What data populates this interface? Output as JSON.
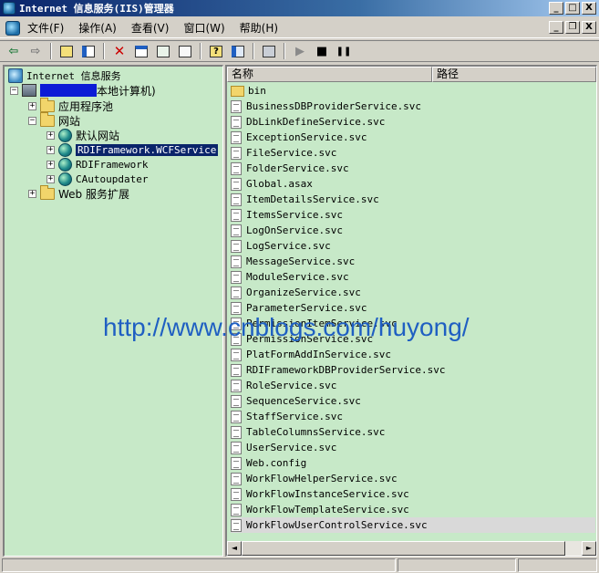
{
  "window": {
    "title": "Internet 信息服务(IIS)管理器",
    "controls": {
      "minimize": "_",
      "maximize": "□",
      "close": "X"
    }
  },
  "menubar": {
    "items": [
      {
        "label": "文件(F)"
      },
      {
        "label": "操作(A)"
      },
      {
        "label": "查看(V)"
      },
      {
        "label": "窗口(W)"
      },
      {
        "label": "帮助(H)"
      }
    ],
    "mdi_controls": {
      "minimize": "_",
      "restore": "❐",
      "close": "X"
    }
  },
  "toolbar": {
    "buttons": [
      {
        "icon": "back-icon",
        "glyph": "⇦",
        "color": "#1f7a3a"
      },
      {
        "icon": "forward-icon",
        "glyph": "⇨",
        "color": "#7a7a7a"
      },
      {
        "icon": "up-folder-icon"
      },
      {
        "icon": "show-tree-icon"
      },
      {
        "icon": "delete-icon",
        "glyph": "✕",
        "color": "#cc0000"
      },
      {
        "icon": "properties-icon"
      },
      {
        "icon": "refresh-icon"
      },
      {
        "icon": "export-icon"
      },
      {
        "icon": "help-icon",
        "glyph": "?"
      },
      {
        "icon": "view-icon"
      },
      {
        "icon": "computer-icon"
      },
      {
        "icon": "start-icon",
        "glyph": "▶",
        "color": "#8a8a8a"
      },
      {
        "icon": "stop-icon",
        "glyph": "■",
        "color": "#000000"
      },
      {
        "icon": "pause-icon",
        "glyph": "❚❚",
        "color": "#000000"
      }
    ]
  },
  "tree": {
    "root": {
      "label": "Internet 信息服务"
    },
    "computer": {
      "label": "本地计算机)",
      "expander": "−"
    },
    "app_pools": {
      "label": "应用程序池",
      "expander": "+"
    },
    "websites": {
      "label": "网站",
      "expander": "−"
    },
    "sites": [
      {
        "label": "默认网站",
        "expander": "+",
        "selected": false
      },
      {
        "label": "RDIFramework.WCFService",
        "expander": "+",
        "selected": true
      },
      {
        "label": "RDIFramework",
        "expander": "+",
        "selected": false
      },
      {
        "label": "CAutoupdater",
        "expander": "+",
        "selected": false
      }
    ],
    "web_ext": {
      "label": "Web 服务扩展",
      "expander": "+"
    }
  },
  "list": {
    "columns": [
      {
        "label": "名称"
      },
      {
        "label": "路径"
      }
    ],
    "items": [
      {
        "name": "bin",
        "type": "folder"
      },
      {
        "name": "BusinessDBProviderService.svc",
        "type": "file"
      },
      {
        "name": "DbLinkDefineService.svc",
        "type": "file"
      },
      {
        "name": "ExceptionService.svc",
        "type": "file"
      },
      {
        "name": "FileService.svc",
        "type": "file"
      },
      {
        "name": "FolderService.svc",
        "type": "file"
      },
      {
        "name": "Global.asax",
        "type": "file"
      },
      {
        "name": "ItemDetailsService.svc",
        "type": "file"
      },
      {
        "name": "ItemsService.svc",
        "type": "file"
      },
      {
        "name": "LogOnService.svc",
        "type": "file"
      },
      {
        "name": "LogService.svc",
        "type": "file"
      },
      {
        "name": "MessageService.svc",
        "type": "file"
      },
      {
        "name": "ModuleService.svc",
        "type": "file"
      },
      {
        "name": "OrganizeService.svc",
        "type": "file"
      },
      {
        "name": "ParameterService.svc",
        "type": "file"
      },
      {
        "name": "PermissionItemService.svc",
        "type": "file"
      },
      {
        "name": "PermissionService.svc",
        "type": "file"
      },
      {
        "name": "PlatFormAddInService.svc",
        "type": "file"
      },
      {
        "name": "RDIFrameworkDBProviderService.svc",
        "type": "file"
      },
      {
        "name": "RoleService.svc",
        "type": "file"
      },
      {
        "name": "SequenceService.svc",
        "type": "file"
      },
      {
        "name": "StaffService.svc",
        "type": "file"
      },
      {
        "name": "TableColumnsService.svc",
        "type": "file"
      },
      {
        "name": "UserService.svc",
        "type": "file"
      },
      {
        "name": "Web.config",
        "type": "file"
      },
      {
        "name": "WorkFlowHelperService.svc",
        "type": "file"
      },
      {
        "name": "WorkFlowInstanceService.svc",
        "type": "file"
      },
      {
        "name": "WorkFlowTemplateService.svc",
        "type": "file"
      },
      {
        "name": "WorkFlowUserControlService.svc",
        "type": "file",
        "highlighted": true
      }
    ],
    "scroll": {
      "left": "◄",
      "right": "►"
    }
  },
  "watermark": {
    "text": "http://www.cnblogs.com/huyong/"
  },
  "colors": {
    "pane_bg": "#c7e9c8",
    "selection": "#0a246a",
    "redaction": "#0c1bd6",
    "watermark": "#1f5fc2"
  }
}
